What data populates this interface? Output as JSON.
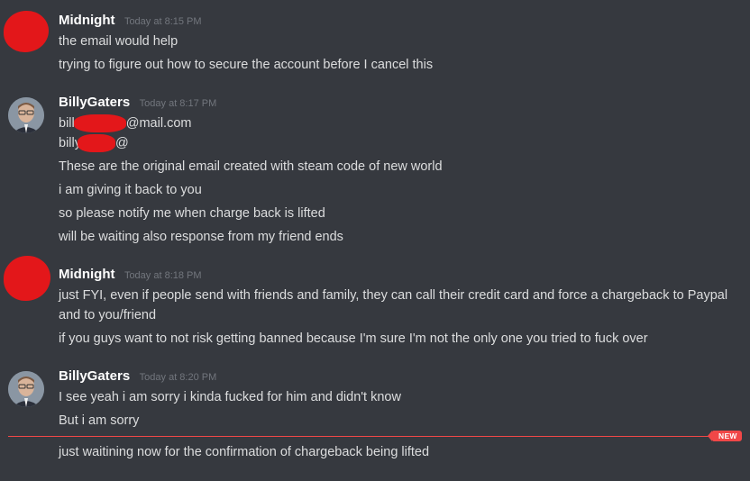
{
  "messages": [
    {
      "username": "Midnight",
      "timestamp": "Today at 8:15 PM",
      "avatar": "redacted-avatar",
      "lines": [
        "the email would help",
        "trying to figure out how to secure the account before I cancel this"
      ]
    },
    {
      "username": "BillyGaters",
      "timestamp": "Today at 8:17 PM",
      "avatar": "user-photo-avatar",
      "email1_prefix": "bill",
      "email1_suffix": "@mail.com",
      "email2_prefix": "billy",
      "email2_suffix": "@",
      "lines": [
        "These are the original email created with steam code of new world",
        "i am giving it back to you",
        "so please notify me when charge back is lifted",
        "will be waiting also response from my friend ends"
      ]
    },
    {
      "username": "Midnight",
      "timestamp": "Today at 8:18 PM",
      "avatar": "redacted-avatar",
      "lines": [
        "just FYI, even if people send with friends and family, they can call their credit card and force a chargeback to Paypal and to you/friend",
        "if you guys want to not risk getting banned because I'm sure I'm not the only one you tried to fuck over"
      ]
    },
    {
      "username": "BillyGaters",
      "timestamp": "Today at 8:20 PM",
      "avatar": "user-photo-avatar",
      "lines": [
        "I see yeah i am sorry i kinda fucked for him and didn't know",
        "But i am sorry",
        "just waitining now for the confirmation of chargeback being lifted"
      ]
    }
  ],
  "new_divider": {
    "label": "NEW",
    "color": "#f04747"
  },
  "colors": {
    "background": "#36393f",
    "username": "#ffffff",
    "text": "#dcddde",
    "timestamp": "#72767d",
    "redaction": "#e3171a"
  }
}
